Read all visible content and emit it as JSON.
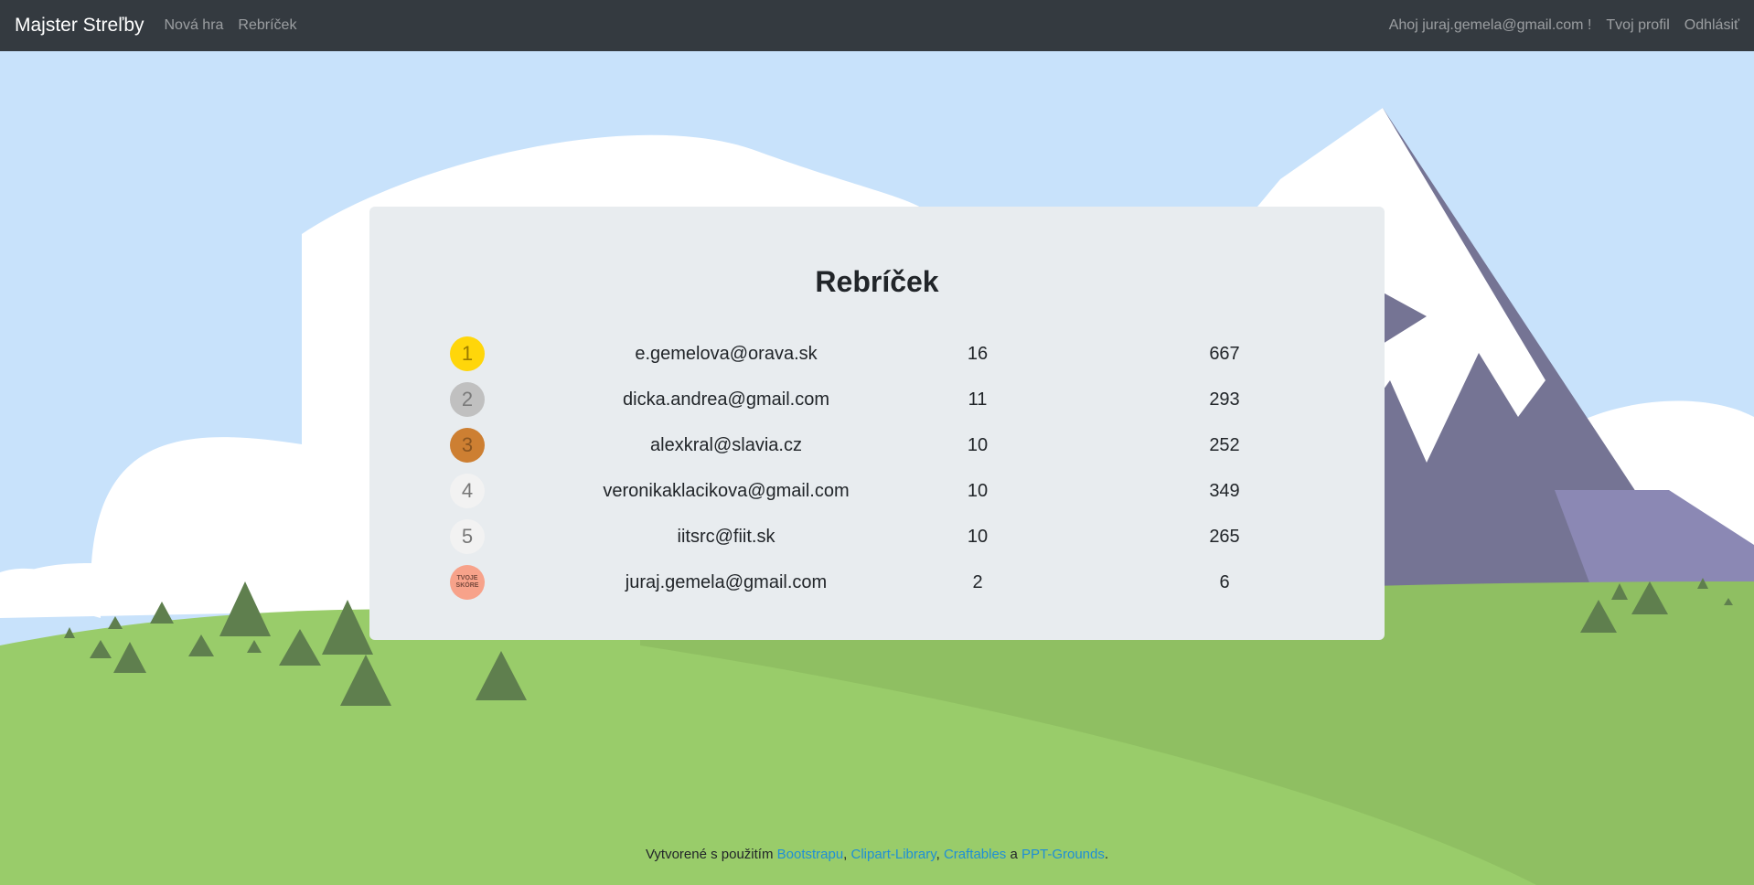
{
  "navbar": {
    "brand": "Majster Streľby",
    "links": [
      "Nová hra",
      "Rebríček"
    ],
    "greeting": "Ahoj juraj.gemela@gmail.com !",
    "profile": "Tvoj profil",
    "logout": "Odhlásiť"
  },
  "leaderboard": {
    "title": "Rebríček",
    "rows": [
      {
        "rank": "1",
        "email": "e.gemelova@orava.sk",
        "a": "16",
        "b": "667",
        "medal_color": "#ffd60a"
      },
      {
        "rank": "2",
        "email": "dicka.andrea@gmail.com",
        "a": "11",
        "b": "293",
        "medal_color": "#c0c0c0"
      },
      {
        "rank": "3",
        "email": "alexkral@slavia.cz",
        "a": "10",
        "b": "252",
        "medal_color": "#cd7f32"
      },
      {
        "rank": "4",
        "email": "veronikaklacikova@gmail.com",
        "a": "10",
        "b": "349",
        "medal_color": "#f2f2f2"
      },
      {
        "rank": "5",
        "email": "iitsrc@fiit.sk",
        "a": "10",
        "b": "265",
        "medal_color": "#f2f2f2"
      },
      {
        "rank": "TVOJE SKÓRE",
        "email": "juraj.gemela@gmail.com",
        "a": "2",
        "b": "6",
        "medal_color": "#f7a28a"
      }
    ]
  },
  "footer": {
    "prefix": "Vytvorené s použitím ",
    "link1": "Bootstrapu",
    "sep1": ", ",
    "link2": "Clipart-Library",
    "sep2": ", ",
    "link3": "Craftables",
    "sep3": " a ",
    "link4": "PPT-Grounds",
    "suffix": "."
  }
}
